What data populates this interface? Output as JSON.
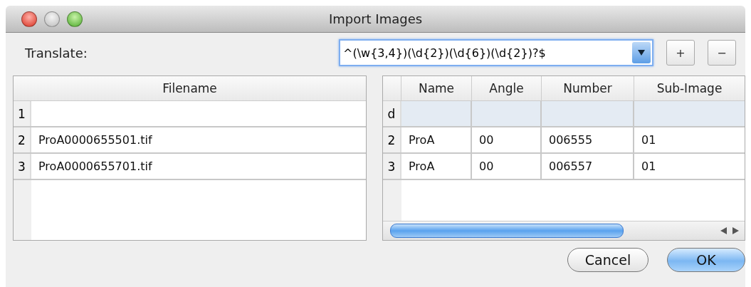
{
  "window": {
    "title": "Import Images"
  },
  "translate": {
    "label": "Translate:",
    "value": "^(\\w{3,4})(\\d{2})(\\d{6})(\\d{2})?$",
    "buttons": [
      "+",
      "−"
    ]
  },
  "filename_table": {
    "columns": [
      "Filename"
    ],
    "rows": [
      {
        "index": "1",
        "cells": [
          ""
        ]
      },
      {
        "index": "2",
        "cells": [
          "ProA0000655501.tif"
        ]
      },
      {
        "index": "3",
        "cells": [
          "ProA0000655701.tif"
        ]
      }
    ]
  },
  "result_table": {
    "columns": [
      "Name",
      "Angle",
      "Number",
      "Sub-Image"
    ],
    "rows": [
      {
        "index": "d",
        "selected": true,
        "cells": [
          "",
          "",
          "",
          ""
        ]
      },
      {
        "index": "2",
        "selected": false,
        "cells": [
          "ProA",
          "00",
          "006555",
          "01"
        ]
      },
      {
        "index": "3",
        "selected": false,
        "cells": [
          "ProA",
          "00",
          "006557",
          "01"
        ]
      }
    ]
  },
  "buttons": [
    {
      "label": "Cancel",
      "default": false
    },
    {
      "label": "OK",
      "default": true
    }
  ]
}
